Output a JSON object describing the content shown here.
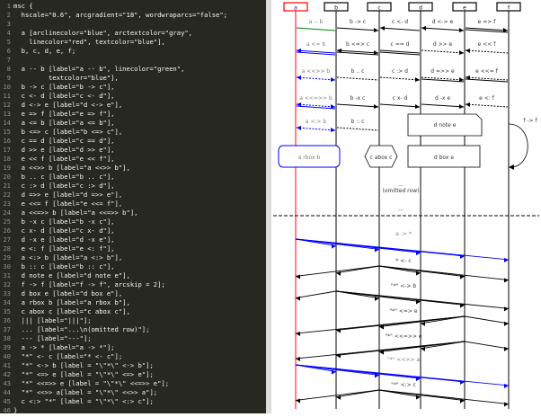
{
  "editor": {
    "lines": [
      "msc {",
      "  hscale=\"0.6\", arcgradient=\"18\", wordwraparcs=\"false\";",
      "",
      "  a [arclinecolor=\"blue\", arctextcolor=\"gray\",",
      "    linecolor=\"red\", textcolor=\"blue\"],",
      "  b, c, d, e, f;",
      "",
      "  a -- b [label=\"a -- b\", linecolor=\"green\",",
      "         textcolor=\"blue\"],",
      "  b -> c [label=\"b -> c\"],",
      "  c <- d [label=\"c <- d\"],",
      "  d <-> e [label=\"d <-> e\"],",
      "  e => f [label=\"e => f\"],",
      "  a <= b [label=\"a <= b\"],",
      "  b <=> c [label=\"b <=> c\"],",
      "  c == d [label=\"c == d\"],",
      "  d >> e [label=\"d >> e\"],",
      "  e << f [label=\"e << f\"],",
      "  a <<>> b [label=\"a <<>> b\"],",
      "  b .. c [label=\"b .. c\"],",
      "  c :> d [label=\"c :> d\"],",
      "  d =>> e [label=\"d =>> e\"],",
      "  e <<= f [label=\"e <<= f\"],",
      "  a <<=>> b [label=\"a <<=>> b\"],",
      "  b -x c [label=\"b -x c\"],",
      "  c x- d [label=\"c x- d\"],",
      "  d -x e [label=\"d -x e\"],",
      "  e <: f [label=\"e <: f\"],",
      "  a <:> b [label=\"a <:> b\"],",
      "  b :: c [label=\"b :: c\"],",
      "  d note e [label=\"d note e\"],",
      "  f -> f [label=\"f -> f\", arcskip = 2];",
      "  d box e [label=\"d box e\"],",
      "  a rbox b [label=\"a rbox b\"],",
      "  c abox c [label=\"c abox c\"],",
      "  ||| [label=\"|||\"];",
      "  ... [label=\"...\\n(omitted row)\"];",
      "  --- [label=\"---\"];",
      "  a -> * [label=\"a -> *\"];",
      "  \"*\" <- c [label=\"* <- c\"];",
      "  \"*\" <-> b [label = \"\\\"*\\\" <-> b\"];",
      "  \"*\" <=> e [label = \"\\\"*\\\" <=> e\"];",
      "  \"*\" <<=>> e [label = \"\\\"*\\\" <<=>> e\"];",
      "  \"*\" <<>> a[label = \"\\\"*\\\" <<>> a\"];",
      "  c <:> \"*\" [label = \"\\\"*\\\" <:> c\"];",
      "}"
    ]
  },
  "chart": {
    "entities": [
      "a",
      "b",
      "c",
      "d",
      "e",
      "f"
    ],
    "arcs": [
      {
        "label": "a -- b"
      },
      {
        "label": "b -> c"
      },
      {
        "label": "c <- d"
      },
      {
        "label": "d <-> e"
      },
      {
        "label": "e => f"
      },
      {
        "label": "a <= b"
      },
      {
        "label": "b <=> c"
      },
      {
        "label": "c == d"
      },
      {
        "label": "d >> e"
      },
      {
        "label": "e << f"
      },
      {
        "label": "a <<>> b"
      },
      {
        "label": "b .. c"
      },
      {
        "label": "c :> d"
      },
      {
        "label": "d =>> e"
      },
      {
        "label": "e <<= f"
      },
      {
        "label": "a <<=>> b"
      },
      {
        "label": "b -x c"
      },
      {
        "label": "c x- d"
      },
      {
        "label": "d -x e"
      },
      {
        "label": "e <: f"
      },
      {
        "label": "a <:> b"
      },
      {
        "label": "b :: c"
      }
    ],
    "note": "d note e",
    "selfarc": "f -> f",
    "boxes": {
      "rbox": "a rbox b",
      "abox": "c abox c",
      "box": "d box e"
    },
    "omitted": [
      "...",
      "(omitted row)"
    ],
    "broadcast": [
      {
        "label": "a -> *"
      },
      {
        "label": "* <- c"
      },
      {
        "label": "\"*\" <-> b"
      },
      {
        "label": "\"*\" <=> e"
      },
      {
        "label": "\"*\" <<=>> e"
      },
      {
        "label": "\"*\" <<>> a"
      },
      {
        "label": "\"*\" <:> c"
      }
    ],
    "colors": {
      "editor_bg": "#272822",
      "entity_a_line": "red",
      "entity_a_text": "blue",
      "arc_a_line": "blue",
      "arc_a_text": "gray",
      "arc_ab_line": "green",
      "separator": "black"
    }
  }
}
